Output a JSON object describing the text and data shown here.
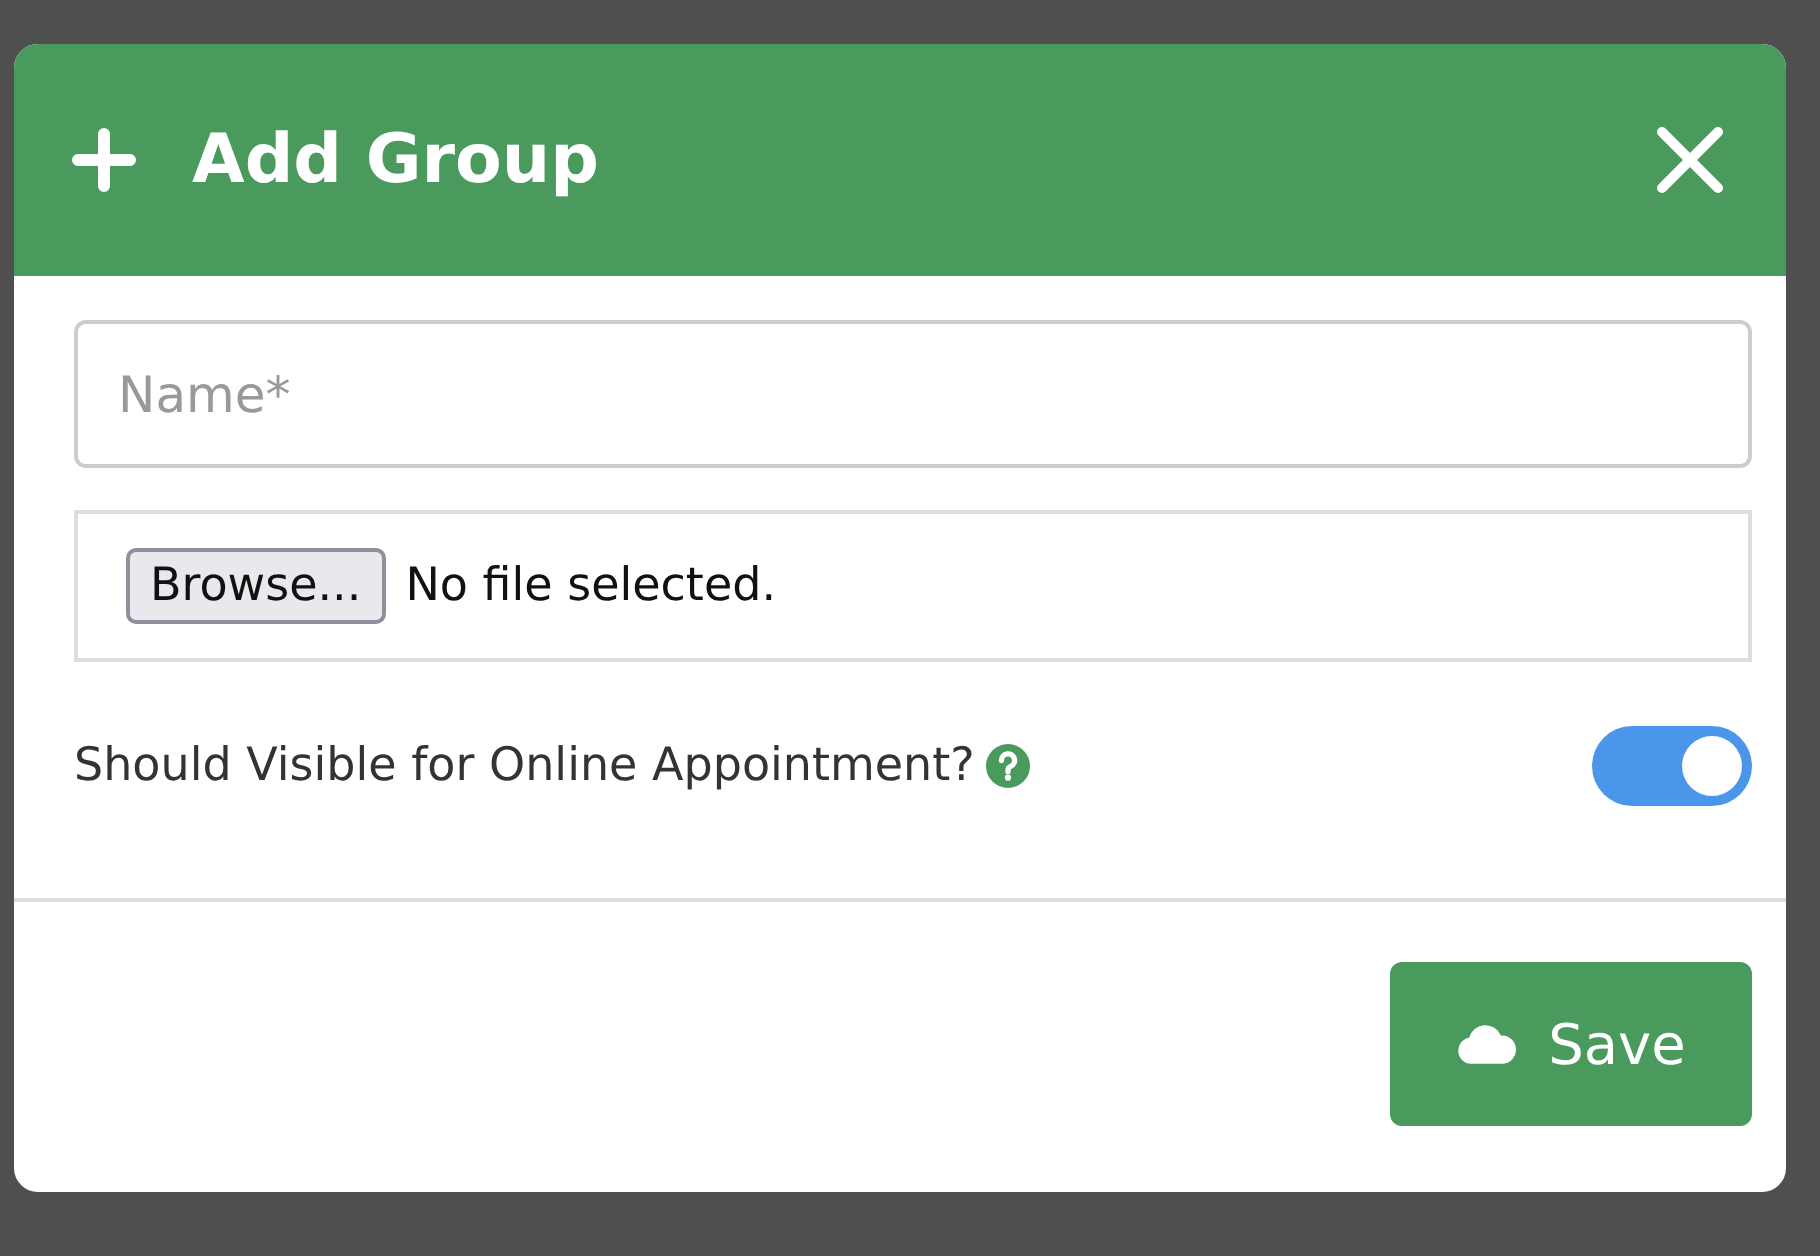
{
  "dialog": {
    "title": "Add Group",
    "name_field": {
      "placeholder": "Name*"
    },
    "file_input": {
      "button": "Browse...",
      "status": "No file selected."
    },
    "visibility_toggle": {
      "label": "Should Visible for Online Appointment?",
      "on": true
    },
    "buttons": [
      {
        "kind": "save",
        "label": "Save"
      }
    ]
  }
}
